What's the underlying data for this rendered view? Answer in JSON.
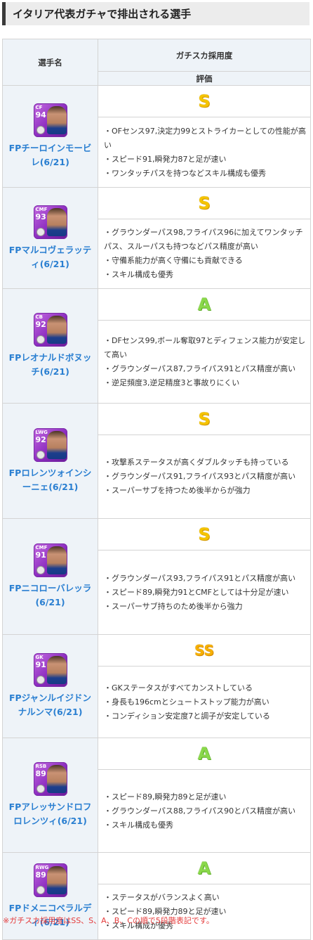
{
  "page_title": "イタリア代表ガチャで排出される選手",
  "table": {
    "col_name_header": "選手名",
    "col_rating_header": "ガチスカ採用度",
    "col_eval_header": "評価"
  },
  "players": [
    {
      "pos": "CF",
      "ovr": "94",
      "name": "FPチーロインモービレ(6/21)",
      "grade": "S",
      "desc": [
        "・OFセンス97,決定力99とストライカーとしての性能が高い",
        "・スピード91,瞬発力87と足が速い",
        "・ワンタッチパスを持つなどスキル構成も優秀"
      ]
    },
    {
      "pos": "CMF",
      "ovr": "93",
      "name": "FPマルコヴェラッティ(6/21)",
      "grade": "S",
      "desc": [
        "・グラウンダーパス98,フライパス96に加えてワンタッチパス、スルーパスも持つなどパス精度が高い",
        "・守備系能力が高く守備にも貢献できる",
        "・スキル構成も優秀"
      ]
    },
    {
      "pos": "CB",
      "ovr": "92",
      "name": "FPレオナルドボヌッチ(6/21)",
      "grade": "A",
      "desc": [
        "・DFセンス99,ボール奪取97とディフェンス能力が安定して高い",
        "・グラウンダーパス87,フライパス91とパス精度が高い",
        "・逆足頻度3,逆足精度3と事故りにくい"
      ]
    },
    {
      "pos": "LWG",
      "ovr": "92",
      "name": "FPロレンツォインシーニェ(6/21)",
      "grade": "S",
      "desc": [
        "・攻撃系ステータスが高くダブルタッチも持っている",
        "・グラウンダーパス91,フライパス93とパス精度が高い",
        "・スーパーサブを持つため後半からが強力"
      ]
    },
    {
      "pos": "CMF",
      "ovr": "91",
      "name": "FPニコローバレッラ(6/21)",
      "grade": "S",
      "desc": [
        "・グラウンダーパス93,フライパス91とパス精度が高い",
        "・スピード89,瞬発力91とCMFとしては十分足が速い",
        "・スーパーサブ持ちのため後半から強力"
      ]
    },
    {
      "pos": "GK",
      "ovr": "91",
      "name": "FPジャンルイジドンナルンマ(6/21)",
      "grade": "SS",
      "desc": [
        "・GKステータスがすべてカンストしている",
        "・身長も196cmとシュートストップ能力が高い",
        "・コンディション安定度7と調子が安定している"
      ]
    },
    {
      "pos": "RSB",
      "ovr": "89",
      "name": "FPアレッサンドロフロレンツィ(6/21)",
      "grade": "A",
      "desc": [
        "・スピード89,瞬発力89と足が速い",
        "・グラウンダーパス88,フライパス90とパス精度が高い",
        "・スキル構成も優秀"
      ]
    },
    {
      "pos": "RWG",
      "ovr": "89",
      "name": "FPドメニコベラルディ(6/21)",
      "grade": "A",
      "desc": [
        "・ステータスがバランスよく高い",
        "・スピード89,瞬発力89と足が速い",
        "・スキル構成が優秀"
      ]
    }
  ],
  "footnote": "※ガチスカ採用度はSS、S、A、B、Cの順で5段階表記です。"
}
